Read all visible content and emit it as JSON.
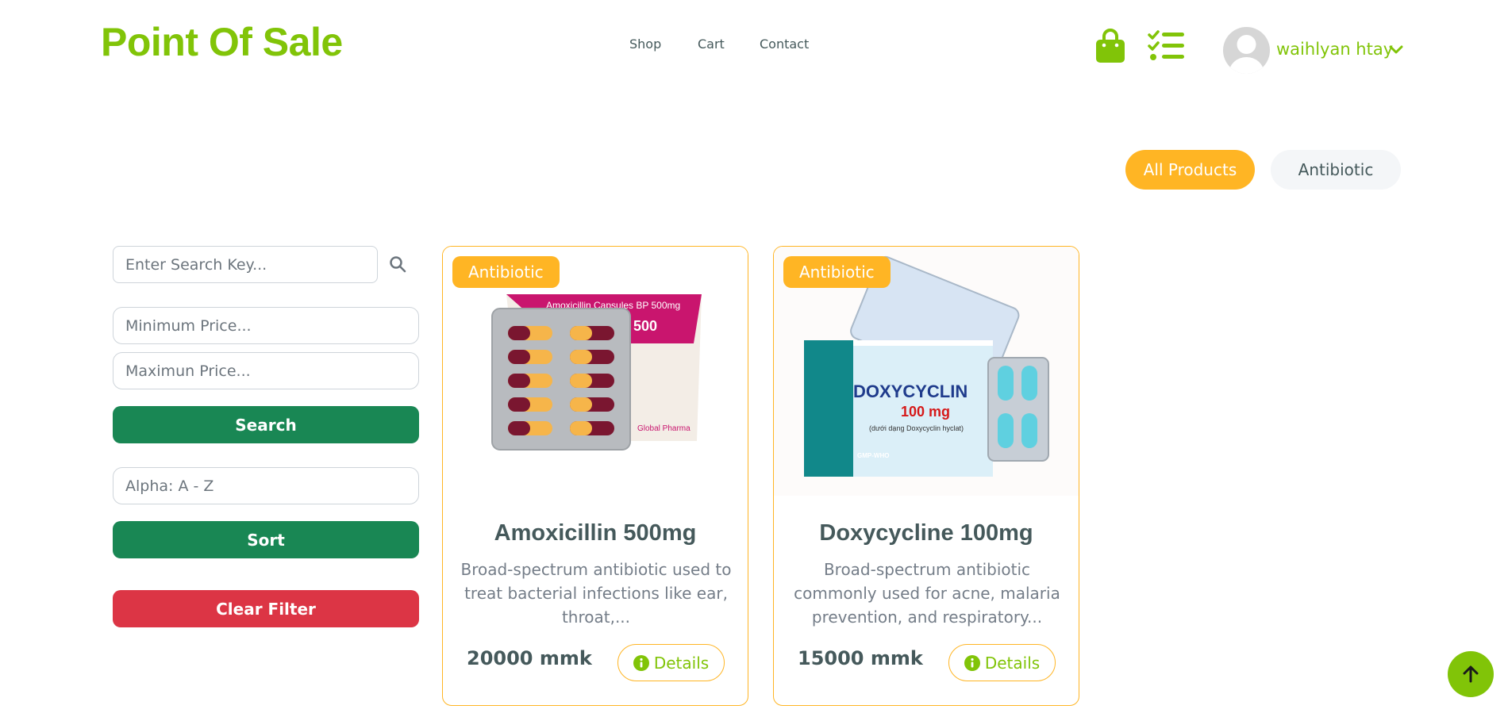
{
  "header": {
    "brand": "Point Of Sale",
    "nav": [
      "Shop",
      "Cart",
      "Contact"
    ],
    "user_name": "waihlyan htay"
  },
  "categories": {
    "all_label": "All Products",
    "items": [
      "Antibiotic"
    ]
  },
  "filters": {
    "search_placeholder": "Enter Search Key...",
    "min_price_placeholder": "Minimum Price...",
    "max_price_placeholder": "Maximun Price...",
    "search_label": "Search",
    "sort_value": "Alpha: A - Z",
    "sort_label": "Sort",
    "clear_label": "Clear Filter"
  },
  "products": [
    {
      "category": "Antibiotic",
      "name": "Amoxicillin 500mg",
      "description": "Broad-spectrum antibiotic used to treat bacterial infections like ear, throat,...",
      "price": "20000 mmk",
      "details_label": "Details",
      "image_text": {
        "line1": "Amoxicillin Capsules BP 500mg",
        "line2": "500",
        "maker": "Global Pharma"
      }
    },
    {
      "category": "Antibiotic",
      "name": "Doxycycline 100mg",
      "description": "Broad-spectrum antibiotic commonly used for acne, malaria prevention, and respiratory...",
      "price": "15000 mmk",
      "details_label": "Details",
      "image_text": {
        "line1": "DOXYCYCLIN",
        "line2": "100 mg",
        "line3": "(dưới dạng Doxycyclin hyclat)",
        "maker": "GMP-WHO"
      }
    }
  ],
  "colors": {
    "brand_green": "#81c408",
    "accent_orange": "#ffb524",
    "button_green": "#198754",
    "button_red": "#dc3545"
  }
}
